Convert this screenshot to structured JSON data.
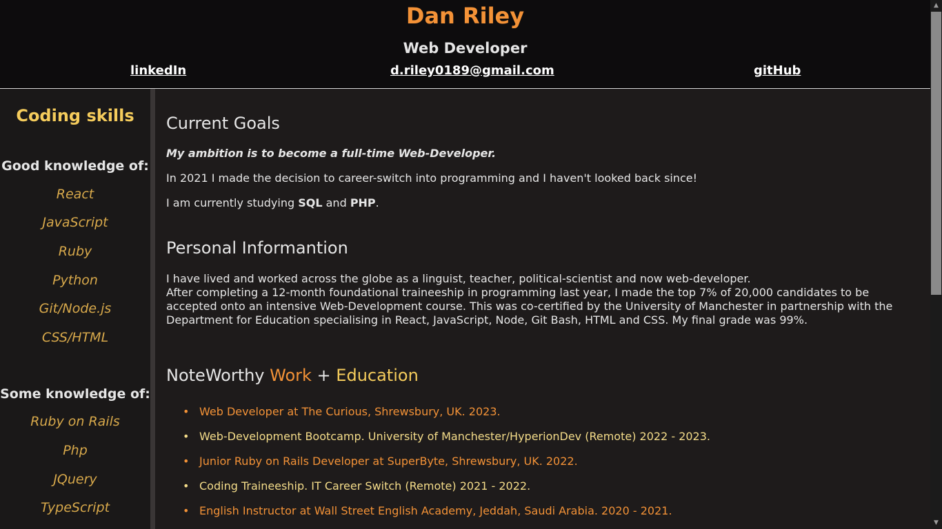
{
  "header": {
    "name": "Dan Riley",
    "role": "Web Developer",
    "links": {
      "linkedin": "linkedIn",
      "email": "d.riley0189@gmail.com",
      "github": "gitHub"
    }
  },
  "sidebar": {
    "title": "Coding skills",
    "good_heading": "Good knowledge of:",
    "good_skills": [
      "React",
      "JavaScript",
      "Ruby",
      "Python",
      "Git/Node.js",
      "CSS/HTML"
    ],
    "some_heading": "Some knowledge of:",
    "some_skills": [
      "Ruby on Rails",
      "Php",
      "JQuery",
      "TypeScript"
    ]
  },
  "goals": {
    "heading": "Current Goals",
    "ambition": "My ambition is to become a full-time Web-Developer.",
    "switch": "In 2021 I made the decision to career-switch into programming and I haven't looked back since!",
    "studying_prefix": "I am currently studying ",
    "studying_sql": "SQL",
    "studying_and": " and ",
    "studying_php": "PHP",
    "studying_suffix": "."
  },
  "personal": {
    "heading": "Personal Informantion",
    "line1": "I have lived and worked across the globe as a linguist, teacher, political-scientist and now web-developer.",
    "line2": "After completing a 12-month foundational traineeship in programming last year, I made the top 7% of 20,000 candidates to be accepted onto an intensive Web-Development course. This was co-certified by the University of Manchester in partnership with the Department for Education specialising in React, JavaScript, Node, Git Bash, HTML and CSS. My final grade was 99%."
  },
  "noteworthy": {
    "heading_prefix": "NoteWorthy ",
    "heading_work": "Work",
    "heading_plus": " + ",
    "heading_edu": "Education",
    "items": [
      "Web Developer at The Curious, Shrewsbury, UK. 2023.",
      "Web-Development Bootcamp. University of Manchester/HyperionDev (Remote) 2022 - 2023.",
      "Junior Ruby on Rails Developer at SuperByte, Shrewsbury, UK. 2022.",
      "Coding Traineeship. IT Career Switch (Remote) 2021 - 2022.",
      "English Instructor at Wall Street English Academy, Jeddah, Saudi Arabia. 2020 - 2021."
    ]
  },
  "colors": {
    "accent_orange": "#f39237",
    "accent_yellow": "#f5cc5c",
    "header_bg": "#0d0c0d",
    "page_bg": "#1e1b1b"
  },
  "scrollbar": {
    "up_icon": "triangle-up-icon",
    "down_icon": "triangle-down-icon"
  }
}
